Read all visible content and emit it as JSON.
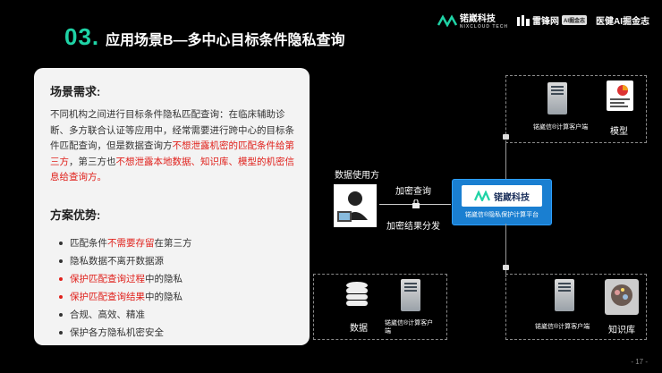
{
  "header": {
    "section_number": "03.",
    "title": "应用场景B—多中心目标条件隐私查询",
    "logos": {
      "brand": "锘崴科技",
      "brand_sub": "NIXCLOUD TECH",
      "partner1": "雷锋网",
      "partner1_badge": "AI掘金志",
      "partner2": "医健AI掘金志"
    }
  },
  "card": {
    "scenario_heading": "场景需求:",
    "scenario_text_part1": "不同机构之间进行目标条件隐私匹配查询：在临床辅助诊断、多方联合认证等应用中，经常需要进行跨中心的目标条件匹配查询，但是数据查询方",
    "scenario_text_red1": "不想泄露机密的匹配条件给第三方",
    "scenario_text_part2": "，第三方也",
    "scenario_text_red2": "不想泄露本地数据、知识库、模型的机密信息给查询方。",
    "advantage_heading": "方案优势:",
    "adv1_pre": "匹配条件",
    "adv1_red": "不需要存留",
    "adv1_post": "在第三方",
    "adv2": "隐私数据不离开数据源",
    "adv3_pre": "保护",
    "adv3_red": "匹配查询过程",
    "adv3_post": "中的隐私",
    "adv4_pre": "保护",
    "adv4_red": "匹配查询结果",
    "adv4_post": "中的隐私",
    "adv5": "合规、高效、精准",
    "adv6": "保护各方隐私机密安全"
  },
  "diagram": {
    "data_user": "数据使用方",
    "encrypted_query": "加密查询",
    "encrypted_result": "加密结果分发",
    "client_label": "锘崴信®计算客户端",
    "model_label": "模型",
    "data_label": "数据",
    "kb_label": "知识库",
    "platform_brand": "锘崴科技",
    "platform_caption": "锘崴信®隐私保护计算平台"
  },
  "page": {
    "number": "- 17 -"
  },
  "colors": {
    "accent": "#1fd3a6",
    "highlight": "#e0201b",
    "platform_blue": "#1a7fd1"
  }
}
